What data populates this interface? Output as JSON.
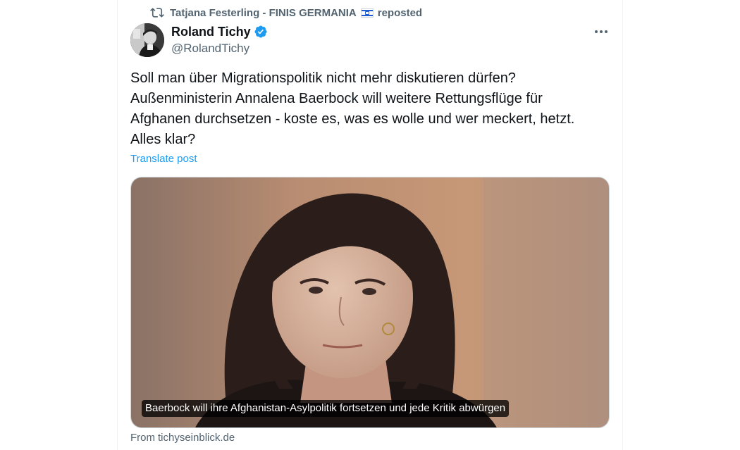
{
  "repost": {
    "icon": "repost-icon",
    "user": "Tatjana Festerling - FINIS GERMANIA",
    "flag": "israel-flag-emoji",
    "suffix": "reposted"
  },
  "author": {
    "name": "Roland Tichy",
    "handle": "@RolandTichy",
    "verified": true,
    "verified_color": "#1d9bf0"
  },
  "post": {
    "lines": [
      "Soll man über Migrationspolitik nicht mehr diskutieren dürfen?",
      "Außenministerin Annalena Baerbock will weitere Rettungsflüge für",
      "Afghanen durchsetzen - koste es, was es wolle und wer meckert, hetzt.",
      "Alles klar?"
    ],
    "translate_label": "Translate post"
  },
  "card": {
    "caption": "Baerbock will ihre Afghanistan-Asylpolitik fortsetzen und jede Kritik abwürgen",
    "source_prefix": "From",
    "source_domain": "tichyseinblick.de"
  },
  "colors": {
    "text_primary": "#0f1419",
    "text_secondary": "#536471",
    "link": "#1d9bf0",
    "border": "#cfd9de"
  }
}
